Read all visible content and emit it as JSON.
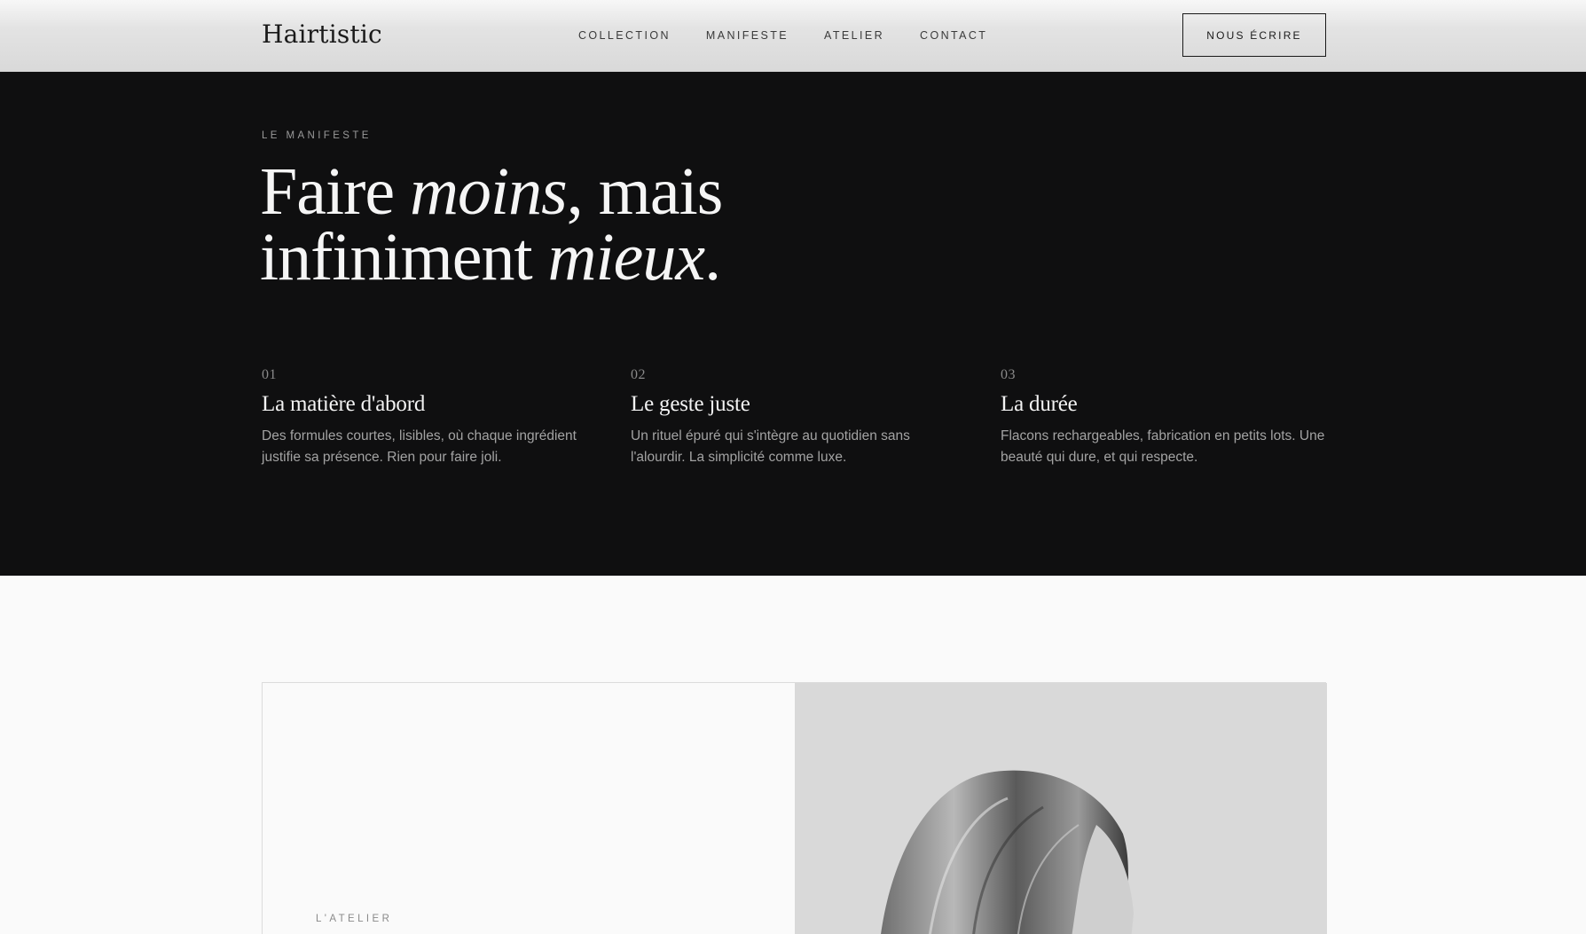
{
  "brand": {
    "name": "Hairtistic"
  },
  "nav": {
    "items": [
      {
        "label": "COLLECTION"
      },
      {
        "label": "MANIFESTE"
      },
      {
        "label": "ATELIER"
      },
      {
        "label": "CONTACT"
      }
    ],
    "cta_label": "NOUS ÉCRIRE"
  },
  "manifesto": {
    "eyebrow": "LE MANIFESTE",
    "headline": {
      "line1_a": "Faire ",
      "line1_em": "moins",
      "line1_b": ", mais",
      "line2_a": "infiniment ",
      "line2_em": "mieux",
      "line2_b": "."
    },
    "columns": [
      {
        "number": "01",
        "title": "La matière d'abord",
        "text": "Des formules courtes, lisibles, où chaque ingrédient justifie sa présence. Rien pour faire joli."
      },
      {
        "number": "02",
        "title": "Le geste juste",
        "text": "Un rituel épuré qui s'intègre au quotidien sans l'alourdir. La simplicité comme luxe."
      },
      {
        "number": "03",
        "title": "La durée",
        "text": "Flacons rechargeables, fabrication en petits lots. Une beauté qui dure, et qui respecte."
      }
    ]
  },
  "atelier": {
    "eyebrow": "L'ATELIER"
  },
  "colors": {
    "dark_section": "#0f0f10",
    "page_bg": "#fafafa",
    "accent_text": "#f5f5f5"
  }
}
